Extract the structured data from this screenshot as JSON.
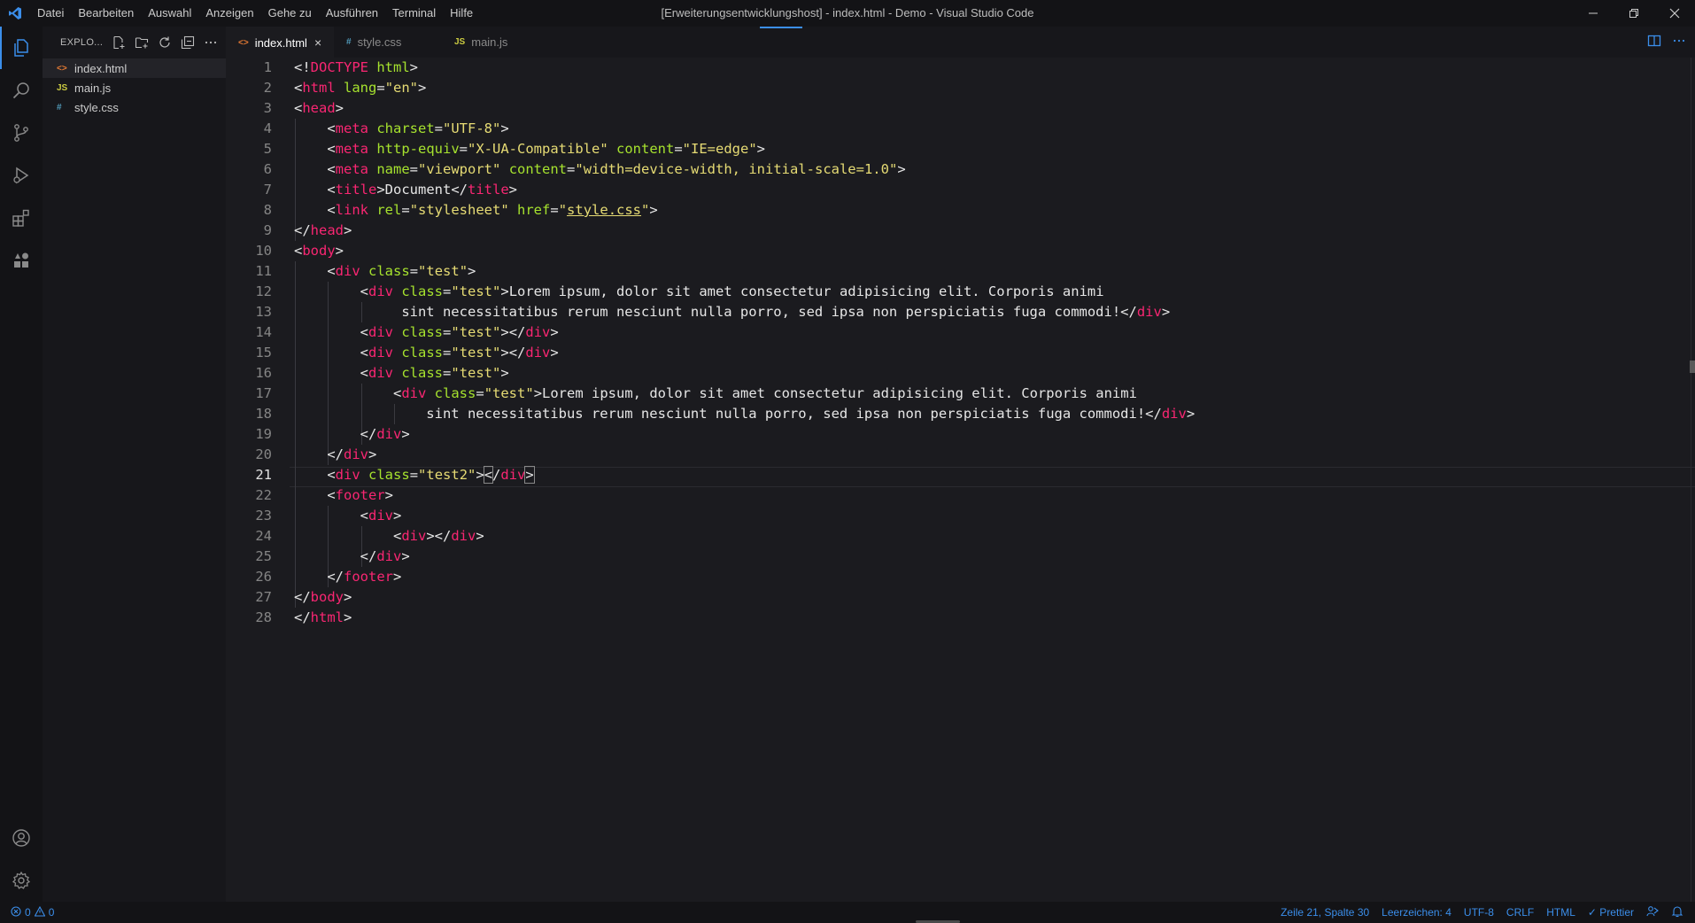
{
  "titlebar": {
    "menu": [
      "Datei",
      "Bearbeiten",
      "Auswahl",
      "Anzeigen",
      "Gehe zu",
      "Ausführen",
      "Terminal",
      "Hilfe"
    ],
    "window_title": "[Erweiterungsentwicklungshost] - index.html - Demo - Visual Studio Code"
  },
  "sidebar": {
    "title": "EXPLO...",
    "files": [
      {
        "icon": "<>",
        "name": "index.html",
        "color": "#e37933"
      },
      {
        "icon": "JS",
        "name": "main.js",
        "color": "#cbcb41"
      },
      {
        "icon": "#",
        "name": "style.css",
        "color": "#519aba"
      }
    ]
  },
  "tabs": [
    {
      "icon": "<>",
      "label": "index.html",
      "active": true,
      "color": "#e37933"
    },
    {
      "icon": "#",
      "label": "style.css",
      "active": false,
      "color": "#519aba"
    },
    {
      "icon": "JS",
      "label": "main.js",
      "active": false,
      "color": "#cbcb41"
    }
  ],
  "tab_close": "×",
  "line_numbers": [
    "1",
    "2",
    "3",
    "4",
    "5",
    "6",
    "7",
    "8",
    "9",
    "10",
    "11",
    "12",
    "13",
    "14",
    "15",
    "16",
    "17",
    "18",
    "19",
    "20",
    "21",
    "22",
    "23",
    "24",
    "25",
    "26",
    "27",
    "28"
  ],
  "current_line": 21,
  "code_lines": [
    [
      [
        "p",
        "<!"
      ],
      [
        "t",
        "DOCTYPE"
      ],
      [
        "p",
        " "
      ],
      [
        "a",
        "html"
      ],
      [
        "p",
        ">"
      ]
    ],
    [
      [
        "p",
        "<"
      ],
      [
        "t",
        "html"
      ],
      [
        "p",
        " "
      ],
      [
        "a",
        "lang"
      ],
      [
        "p",
        "="
      ],
      [
        "s",
        "\"en\""
      ],
      [
        "p",
        ">"
      ]
    ],
    [
      [
        "p",
        "<"
      ],
      [
        "t",
        "head"
      ],
      [
        "p",
        ">"
      ]
    ],
    [
      [
        "p",
        "    <"
      ],
      [
        "t",
        "meta"
      ],
      [
        "p",
        " "
      ],
      [
        "a",
        "charset"
      ],
      [
        "p",
        "="
      ],
      [
        "s",
        "\"UTF-8\""
      ],
      [
        "p",
        ">"
      ]
    ],
    [
      [
        "p",
        "    <"
      ],
      [
        "t",
        "meta"
      ],
      [
        "p",
        " "
      ],
      [
        "a",
        "http-equiv"
      ],
      [
        "p",
        "="
      ],
      [
        "s",
        "\"X-UA-Compatible\""
      ],
      [
        "p",
        " "
      ],
      [
        "a",
        "content"
      ],
      [
        "p",
        "="
      ],
      [
        "s",
        "\"IE=edge\""
      ],
      [
        "p",
        ">"
      ]
    ],
    [
      [
        "p",
        "    <"
      ],
      [
        "t",
        "meta"
      ],
      [
        "p",
        " "
      ],
      [
        "a",
        "name"
      ],
      [
        "p",
        "="
      ],
      [
        "s",
        "\"viewport\""
      ],
      [
        "p",
        " "
      ],
      [
        "a",
        "content"
      ],
      [
        "p",
        "="
      ],
      [
        "s",
        "\"width=device-width, initial-scale=1.0\""
      ],
      [
        "p",
        ">"
      ]
    ],
    [
      [
        "p",
        "    <"
      ],
      [
        "t",
        "title"
      ],
      [
        "p",
        ">Document</"
      ],
      [
        "t",
        "title"
      ],
      [
        "p",
        ">"
      ]
    ],
    [
      [
        "p",
        "    <"
      ],
      [
        "t",
        "link"
      ],
      [
        "p",
        " "
      ],
      [
        "a",
        "rel"
      ],
      [
        "p",
        "="
      ],
      [
        "s",
        "\"stylesheet\""
      ],
      [
        "p",
        " "
      ],
      [
        "a",
        "href"
      ],
      [
        "p",
        "="
      ],
      [
        "s",
        "\""
      ],
      [
        "su",
        "style.css"
      ],
      [
        "s",
        "\""
      ],
      [
        "p",
        ">"
      ]
    ],
    [
      [
        "p",
        "</"
      ],
      [
        "t",
        "head"
      ],
      [
        "p",
        ">"
      ]
    ],
    [
      [
        "p",
        "<"
      ],
      [
        "t",
        "body"
      ],
      [
        "p",
        ">"
      ]
    ],
    [
      [
        "p",
        "    <"
      ],
      [
        "t",
        "div"
      ],
      [
        "p",
        " "
      ],
      [
        "a",
        "class"
      ],
      [
        "p",
        "="
      ],
      [
        "s",
        "\"test\""
      ],
      [
        "p",
        ">"
      ]
    ],
    [
      [
        "p",
        "        <"
      ],
      [
        "t",
        "div"
      ],
      [
        "p",
        " "
      ],
      [
        "a",
        "class"
      ],
      [
        "p",
        "="
      ],
      [
        "s",
        "\"test\""
      ],
      [
        "p",
        ">Lorem ipsum, dolor sit amet consectetur adipisicing elit. Corporis animi"
      ]
    ],
    [
      [
        "p",
        "             sint necessitatibus rerum nesciunt nulla porro, sed ipsa non perspiciatis fuga commodi!</"
      ],
      [
        "t",
        "div"
      ],
      [
        "p",
        ">"
      ]
    ],
    [
      [
        "p",
        "        <"
      ],
      [
        "t",
        "div"
      ],
      [
        "p",
        " "
      ],
      [
        "a",
        "class"
      ],
      [
        "p",
        "="
      ],
      [
        "s",
        "\"test\""
      ],
      [
        "p",
        "></"
      ],
      [
        "t",
        "div"
      ],
      [
        "p",
        ">"
      ]
    ],
    [
      [
        "p",
        "        <"
      ],
      [
        "t",
        "div"
      ],
      [
        "p",
        " "
      ],
      [
        "a",
        "class"
      ],
      [
        "p",
        "="
      ],
      [
        "s",
        "\"test\""
      ],
      [
        "p",
        "></"
      ],
      [
        "t",
        "div"
      ],
      [
        "p",
        ">"
      ]
    ],
    [
      [
        "p",
        "        <"
      ],
      [
        "t",
        "div"
      ],
      [
        "p",
        " "
      ],
      [
        "a",
        "class"
      ],
      [
        "p",
        "="
      ],
      [
        "s",
        "\"test\""
      ],
      [
        "p",
        ">"
      ]
    ],
    [
      [
        "p",
        "            <"
      ],
      [
        "t",
        "div"
      ],
      [
        "p",
        " "
      ],
      [
        "a",
        "class"
      ],
      [
        "p",
        "="
      ],
      [
        "s",
        "\"test\""
      ],
      [
        "p",
        ">Lorem ipsum, dolor sit amet consectetur adipisicing elit. Corporis animi"
      ]
    ],
    [
      [
        "p",
        "                sint necessitatibus rerum nesciunt nulla porro, sed ipsa non perspiciatis fuga commodi!</"
      ],
      [
        "t",
        "div"
      ],
      [
        "p",
        ">"
      ]
    ],
    [
      [
        "p",
        "        </"
      ],
      [
        "t",
        "div"
      ],
      [
        "p",
        ">"
      ]
    ],
    [
      [
        "p",
        "    </"
      ],
      [
        "t",
        "div"
      ],
      [
        "p",
        ">"
      ]
    ],
    [
      [
        "p",
        "    <"
      ],
      [
        "t",
        "div"
      ],
      [
        "p",
        " "
      ],
      [
        "a",
        "class"
      ],
      [
        "p",
        "="
      ],
      [
        "s",
        "\"test2\""
      ],
      [
        "p",
        ">"
      ],
      [
        "pb",
        "<"
      ],
      [
        "p",
        "/"
      ],
      [
        "t",
        "div"
      ],
      [
        "pb",
        ">"
      ]
    ],
    [
      [
        "p",
        "    <"
      ],
      [
        "t",
        "footer"
      ],
      [
        "p",
        ">"
      ]
    ],
    [
      [
        "p",
        "        <"
      ],
      [
        "t",
        "div"
      ],
      [
        "p",
        ">"
      ]
    ],
    [
      [
        "p",
        "            <"
      ],
      [
        "t",
        "div"
      ],
      [
        "p",
        "></"
      ],
      [
        "t",
        "div"
      ],
      [
        "p",
        ">"
      ]
    ],
    [
      [
        "p",
        "        </"
      ],
      [
        "t",
        "div"
      ],
      [
        "p",
        ">"
      ]
    ],
    [
      [
        "p",
        "    </"
      ],
      [
        "t",
        "footer"
      ],
      [
        "p",
        ">"
      ]
    ],
    [
      [
        "p",
        "</"
      ],
      [
        "t",
        "body"
      ],
      [
        "p",
        ">"
      ]
    ],
    [
      [
        "p",
        "</"
      ],
      [
        "t",
        "html"
      ],
      [
        "p",
        ">"
      ]
    ]
  ],
  "status": {
    "errors": "0",
    "warnings": "0",
    "position": "Zeile 21, Spalte 30",
    "indent": "Leerzeichen: 4",
    "encoding": "UTF-8",
    "eol": "CRLF",
    "language": "HTML",
    "formatter": "✓ Prettier"
  },
  "colors": {
    "accent": "#3b8eea",
    "tag": "#f92672",
    "attribute": "#a6e22e",
    "string": "#e6db74"
  }
}
